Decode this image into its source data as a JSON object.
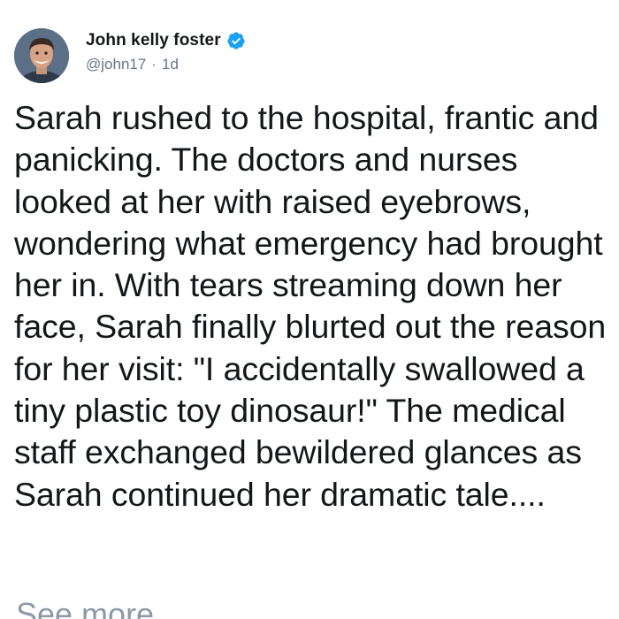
{
  "tweet": {
    "author": {
      "display_name": "John kelly foster",
      "handle": "@john17",
      "verified": true,
      "verified_icon": "verified-badge-icon",
      "avatar_icon": "avatar-photo"
    },
    "timestamp": "1d",
    "separator": "·",
    "text": "Sarah rushed to the hospital, frantic and panicking. The doctors and nurses looked at her with raised eyebrows, wondering what emergency had brought her in. With tears streaming down her face, Sarah finally blurted out the reason for her visit: \"I accidentally swallowed a tiny plastic toy dinosaur!\" The medical staff exchanged bewildered glances as Sarah continued her dramatic tale....",
    "see_more_label": "See more"
  },
  "colors": {
    "text": "#14171a",
    "secondary": "#657786",
    "verified_blue": "#1da1f2",
    "see_more": "#8a9aa8"
  }
}
